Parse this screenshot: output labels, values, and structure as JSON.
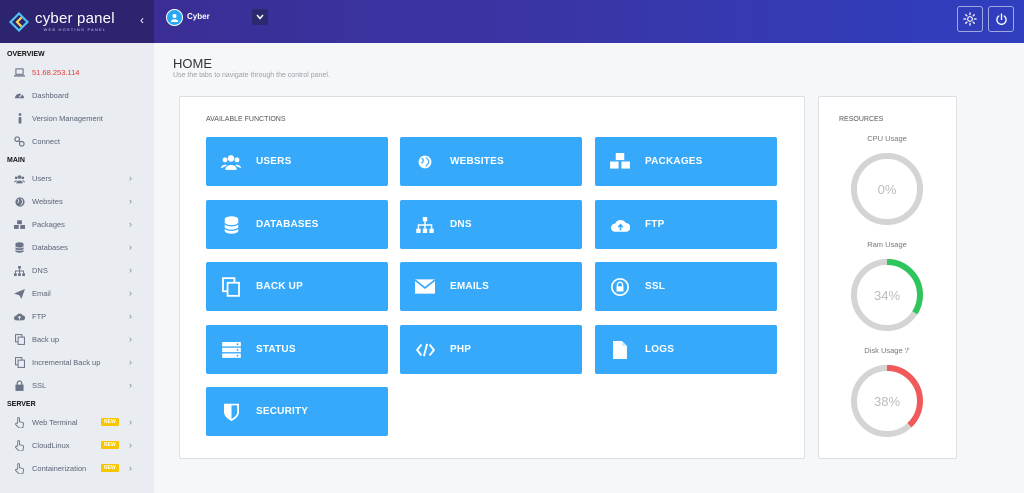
{
  "brand": {
    "name": "cyber panel",
    "tagline": "WEB HOSTING PANEL"
  },
  "header": {
    "username": "Cyber",
    "icons": [
      "settings-gear-icon",
      "power-icon"
    ]
  },
  "sidebar": {
    "overview_heading": "OVERVIEW",
    "overview_items": [
      {
        "label": "51.68.253.114",
        "icon": "laptop-icon"
      },
      {
        "label": "Dashboard",
        "icon": "dashboard-icon"
      },
      {
        "label": "Version Management",
        "icon": "info-icon"
      },
      {
        "label": "Connect",
        "icon": "link-icon"
      }
    ],
    "main_heading": "MAIN",
    "main_items": [
      {
        "label": "Users",
        "icon": "users-icon"
      },
      {
        "label": "Websites",
        "icon": "globe-icon"
      },
      {
        "label": "Packages",
        "icon": "packages-icon"
      },
      {
        "label": "Databases",
        "icon": "database-icon"
      },
      {
        "label": "DNS",
        "icon": "sitemap-icon"
      },
      {
        "label": "Email",
        "icon": "paper-plane-icon"
      },
      {
        "label": "FTP",
        "icon": "cloud-upload-icon"
      },
      {
        "label": "Back up",
        "icon": "copy-icon"
      },
      {
        "label": "Incremental Back up",
        "icon": "copy-icon"
      },
      {
        "label": "SSL",
        "icon": "lock-icon"
      }
    ],
    "server_heading": "SERVER",
    "server_items": [
      {
        "label": "Web Terminal",
        "icon": "hand-pointer-icon",
        "badge": "NEW"
      },
      {
        "label": "CloudLinux",
        "icon": "hand-pointer-icon",
        "badge": "NEW"
      },
      {
        "label": "Containerization",
        "icon": "hand-pointer-icon",
        "badge": "NEW"
      }
    ]
  },
  "main": {
    "title": "HOME",
    "subtitle": "Use the tabs to navigate through the control panel."
  },
  "functions": {
    "heading": "AVAILABLE FUNCTIONS",
    "items": [
      {
        "label": "USERS",
        "icon": "users-icon"
      },
      {
        "label": "WEBSITES",
        "icon": "globe-icon"
      },
      {
        "label": "PACKAGES",
        "icon": "cubes-icon"
      },
      {
        "label": "DATABASES",
        "icon": "database-icon"
      },
      {
        "label": "DNS",
        "icon": "sitemap-icon"
      },
      {
        "label": "FTP",
        "icon": "cloud-upload-icon"
      },
      {
        "label": "BACK UP",
        "icon": "copy-icon"
      },
      {
        "label": "EMAILS",
        "icon": "envelope-icon"
      },
      {
        "label": "SSL",
        "icon": "lock-icon"
      },
      {
        "label": "STATUS",
        "icon": "server-icon"
      },
      {
        "label": "PHP",
        "icon": "code-icon"
      },
      {
        "label": "LOGS",
        "icon": "file-icon"
      },
      {
        "label": "SECURITY",
        "icon": "shield-icon"
      }
    ]
  },
  "resources": {
    "heading": "RESOURCES",
    "gauges": [
      {
        "label": "CPU Usage",
        "value": "0%",
        "percent": 0,
        "color": "#2fc55e"
      },
      {
        "label": "Ram Usage",
        "value": "34%",
        "percent": 34,
        "color": "#2fc55e"
      },
      {
        "label": "Disk Usage '/'",
        "value": "38%",
        "percent": 38,
        "color": "#f05a5a"
      }
    ]
  },
  "colors": {
    "accent": "#36a9fb",
    "topbar": "#3a35a6",
    "ip": "#e53935",
    "badge": "#f7c600"
  }
}
